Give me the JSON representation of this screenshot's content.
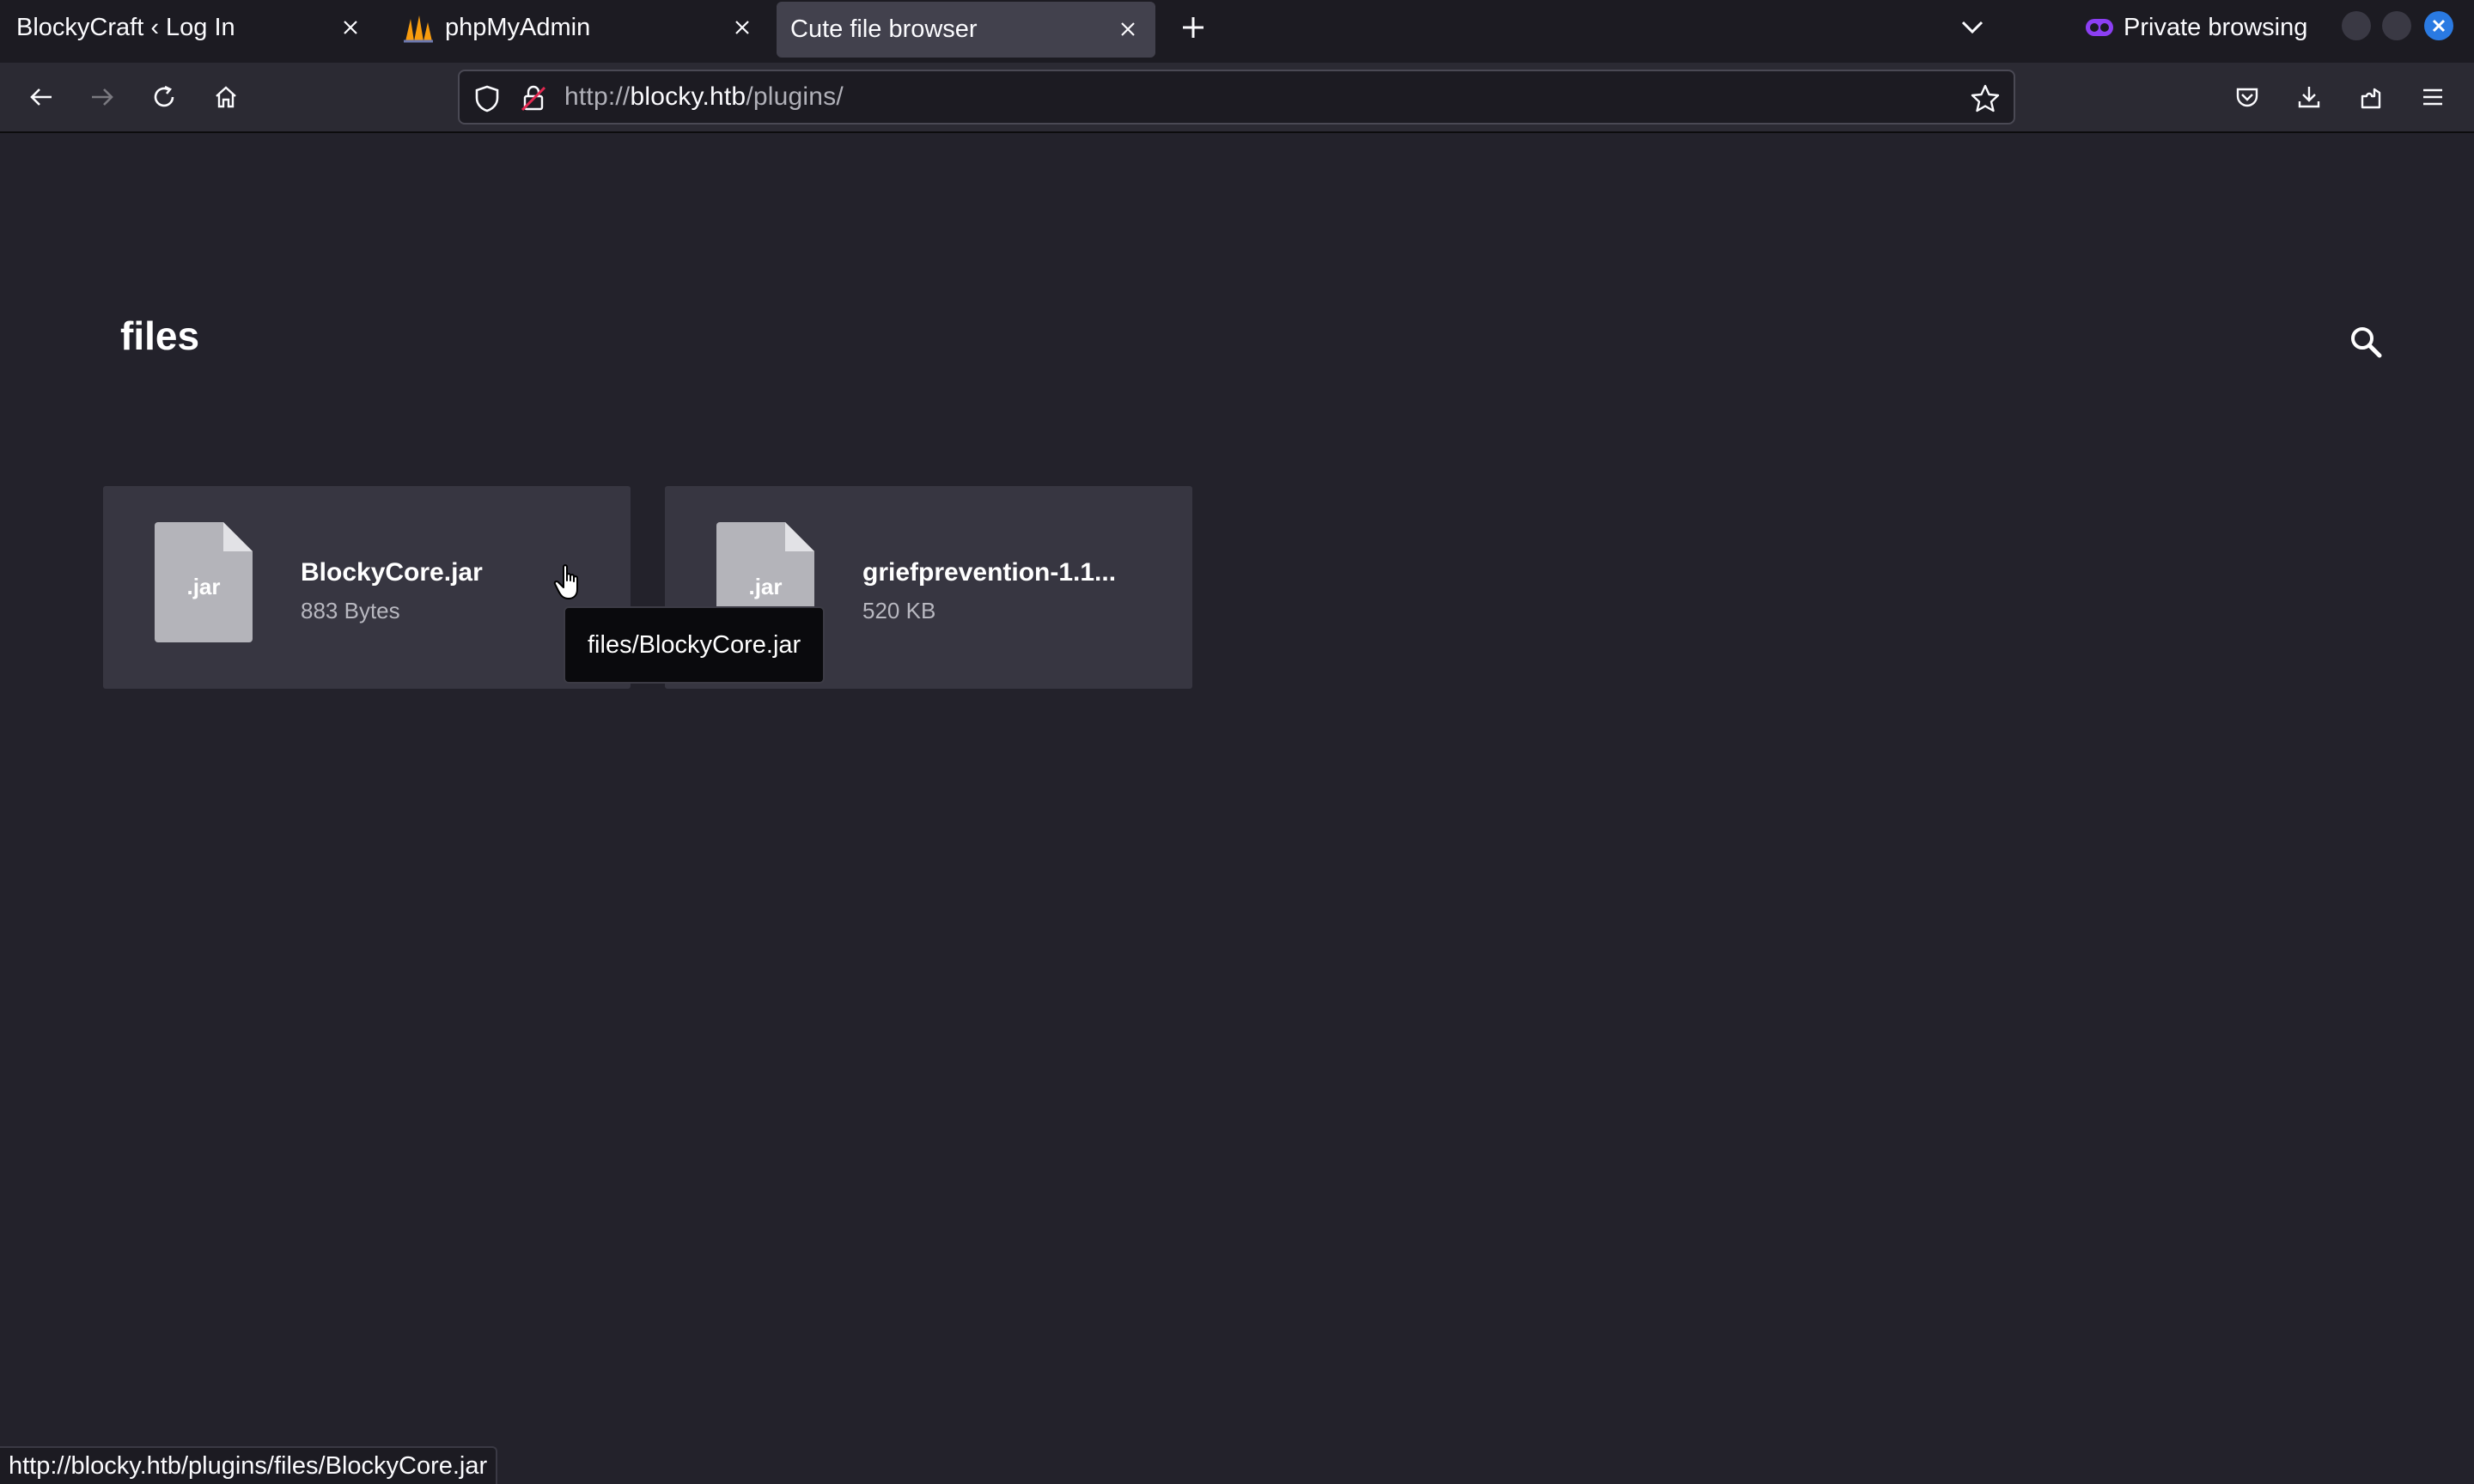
{
  "browser": {
    "tabs": [
      {
        "title": "BlockyCraft ‹ Log In",
        "active": false
      },
      {
        "title": "phpMyAdmin",
        "active": false,
        "favicon": "phpmyadmin-sail-icon"
      },
      {
        "title": "Cute file browser",
        "active": true
      }
    ],
    "private_label": "Private browsing",
    "url": {
      "scheme": "http://",
      "host": "blocky.htb",
      "path": "/plugins/"
    },
    "status_url": "http://blocky.htb/plugins/files/BlockyCore.jar"
  },
  "page": {
    "heading": "files",
    "files": [
      {
        "name": "BlockyCore.jar",
        "size": "883 Bytes",
        "ext": ".jar"
      },
      {
        "name": "griefprevention-1.1...",
        "size": "520 KB",
        "ext": ".jar"
      }
    ],
    "tooltip": "files/BlockyCore.jar"
  },
  "colors": {
    "page_bg": "#23222b",
    "card_bg": "#373641",
    "tab_active_bg": "#42414d",
    "close_accent": "#2a7ae2"
  }
}
